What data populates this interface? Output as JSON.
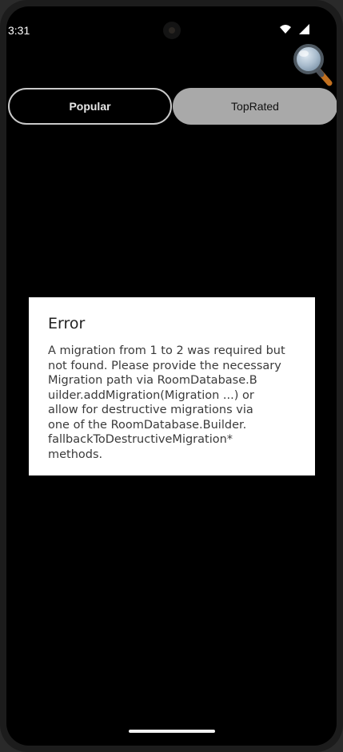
{
  "status_bar": {
    "time": "3:31",
    "icons": [
      "wifi-icon",
      "cellular-signal-icon"
    ]
  },
  "toolbar": {
    "search_icon": "magnifying-glass-icon"
  },
  "tabs": [
    {
      "label": "Popular",
      "selected": false
    },
    {
      "label": "TopRated",
      "selected": true
    }
  ],
  "dialog": {
    "title": "Error",
    "message": "A migration from 1 to 2 was required but\nnot found. Please provide the necessary\nMigration path via RoomDatabase.B\nuilder.addMigration(Migration ...) or\nallow for destructive migrations via\none of the RoomDatabase.Builder.\nfallbackToDestructiveMigration*\nmethods."
  },
  "colors": {
    "background": "#000000",
    "tab_selected": "#a9a9a9",
    "tab_border": "#c9c9c9",
    "dialog_background": "#ffffff"
  }
}
